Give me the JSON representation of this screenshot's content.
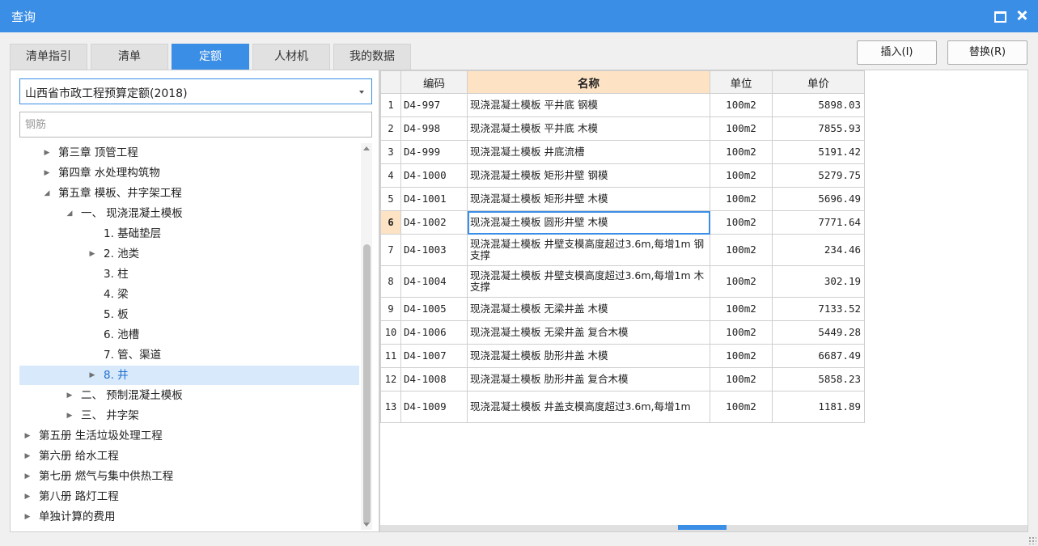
{
  "window": {
    "title": "查询"
  },
  "tabs": [
    {
      "label": "清单指引"
    },
    {
      "label": "清单"
    },
    {
      "label": "定额",
      "active": true
    },
    {
      "label": "人材机"
    },
    {
      "label": "我的数据"
    }
  ],
  "actions": {
    "insert_label": "插入(I)",
    "replace_label": "替换(R)"
  },
  "left_panel": {
    "quota_select": "山西省市政工程预算定额(2018)",
    "search": {
      "value": "",
      "placeholder": "钢筋"
    },
    "tree": [
      {
        "label": "第三章 顶管工程",
        "level": 1,
        "expand": "collapsed"
      },
      {
        "label": "第四章 水处理构筑物",
        "level": 1,
        "expand": "collapsed"
      },
      {
        "label": "第五章 模板、井字架工程",
        "level": 1,
        "expand": "expanded"
      },
      {
        "label": "一、 现浇混凝土模板",
        "level": 2,
        "expand": "expanded"
      },
      {
        "label": "1. 基础垫层",
        "level": 3,
        "expand": "none"
      },
      {
        "label": "2. 池类",
        "level": 3,
        "expand": "collapsed"
      },
      {
        "label": "3. 柱",
        "level": 3,
        "expand": "none"
      },
      {
        "label": "4. 梁",
        "level": 3,
        "expand": "none"
      },
      {
        "label": "5. 板",
        "level": 3,
        "expand": "none"
      },
      {
        "label": "6. 池槽",
        "level": 3,
        "expand": "none"
      },
      {
        "label": "7. 管、渠道",
        "level": 3,
        "expand": "none"
      },
      {
        "label": "8. 井",
        "level": 3,
        "expand": "collapsed",
        "selected": true
      },
      {
        "label": "二、 预制混凝土模板",
        "level": 2,
        "expand": "collapsed"
      },
      {
        "label": "三、 井字架",
        "level": 2,
        "expand": "collapsed"
      },
      {
        "label": "第五册 生活垃圾处理工程",
        "level": 0,
        "expand": "collapsed"
      },
      {
        "label": "第六册 给水工程",
        "level": 0,
        "expand": "collapsed"
      },
      {
        "label": "第七册 燃气与集中供热工程",
        "level": 0,
        "expand": "collapsed"
      },
      {
        "label": "第八册 路灯工程",
        "level": 0,
        "expand": "collapsed"
      },
      {
        "label": "单独计算的费用",
        "level": 0,
        "expand": "collapsed"
      }
    ]
  },
  "table": {
    "columns": [
      "",
      "编码",
      "名称",
      "单位",
      "单价"
    ],
    "rows": [
      {
        "no": "1",
        "code": "D4-997",
        "name": "现浇混凝土模板 平井底 钢模",
        "unit": "100m2",
        "price": "5898.03"
      },
      {
        "no": "2",
        "code": "D4-998",
        "name": "现浇混凝土模板 平井底 木模",
        "unit": "100m2",
        "price": "7855.93"
      },
      {
        "no": "3",
        "code": "D4-999",
        "name": "现浇混凝土模板 井底流槽",
        "unit": "100m2",
        "price": "5191.42"
      },
      {
        "no": "4",
        "code": "D4-1000",
        "name": "现浇混凝土模板 矩形井壁 钢模",
        "unit": "100m2",
        "price": "5279.75"
      },
      {
        "no": "5",
        "code": "D4-1001",
        "name": "现浇混凝土模板 矩形井壁 木模",
        "unit": "100m2",
        "price": "5696.49"
      },
      {
        "no": "6",
        "code": "D4-1002",
        "name": "现浇混凝土模板 圆形井壁 木模",
        "unit": "100m2",
        "price": "7771.64",
        "selected": true
      },
      {
        "no": "7",
        "code": "D4-1003",
        "name": "现浇混凝土模板 井壁支模高度超过3.6m,每增1m 钢支撑",
        "unit": "100m2",
        "price": "234.46"
      },
      {
        "no": "8",
        "code": "D4-1004",
        "name": "现浇混凝土模板 井壁支模高度超过3.6m,每增1m 木支撑",
        "unit": "100m2",
        "price": "302.19"
      },
      {
        "no": "9",
        "code": "D4-1005",
        "name": "现浇混凝土模板 无梁井盖 木模",
        "unit": "100m2",
        "price": "7133.52"
      },
      {
        "no": "10",
        "code": "D4-1006",
        "name": "现浇混凝土模板 无梁井盖 复合木模",
        "unit": "100m2",
        "price": "5449.28"
      },
      {
        "no": "11",
        "code": "D4-1007",
        "name": "现浇混凝土模板 肋形井盖 木模",
        "unit": "100m2",
        "price": "6687.49"
      },
      {
        "no": "12",
        "code": "D4-1008",
        "name": "现浇混凝土模板 肋形井盖 复合木模",
        "unit": "100m2",
        "price": "5858.23"
      },
      {
        "no": "13",
        "code": "D4-1009",
        "name": "现浇混凝土模板 井盖支模高度超过3.6m,每增1m",
        "unit": "100m2",
        "price": "1181.89"
      }
    ]
  },
  "colors": {
    "accent": "#3a8ee6",
    "header_highlight": "#fde3c4",
    "tree_selected": "#d7e9fb"
  }
}
